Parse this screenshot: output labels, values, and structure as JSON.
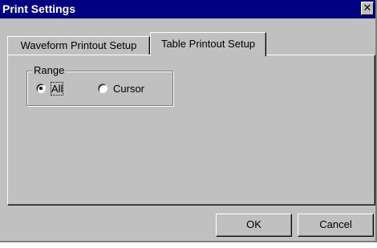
{
  "window": {
    "title": "Print Settings",
    "close_glyph": "✕"
  },
  "tabs": [
    {
      "label": "Waveform Printout Setup",
      "selected": false
    },
    {
      "label": "Table Printout Setup",
      "selected": true
    }
  ],
  "range_group": {
    "label": "Range",
    "options": [
      {
        "label": "All",
        "selected": true
      },
      {
        "label": "Cursor",
        "selected": false
      }
    ]
  },
  "buttons": {
    "ok_label": "OK",
    "cancel_label": "Cancel"
  },
  "colors": {
    "titlebar": "#000080",
    "face": "#c0c0c0"
  }
}
